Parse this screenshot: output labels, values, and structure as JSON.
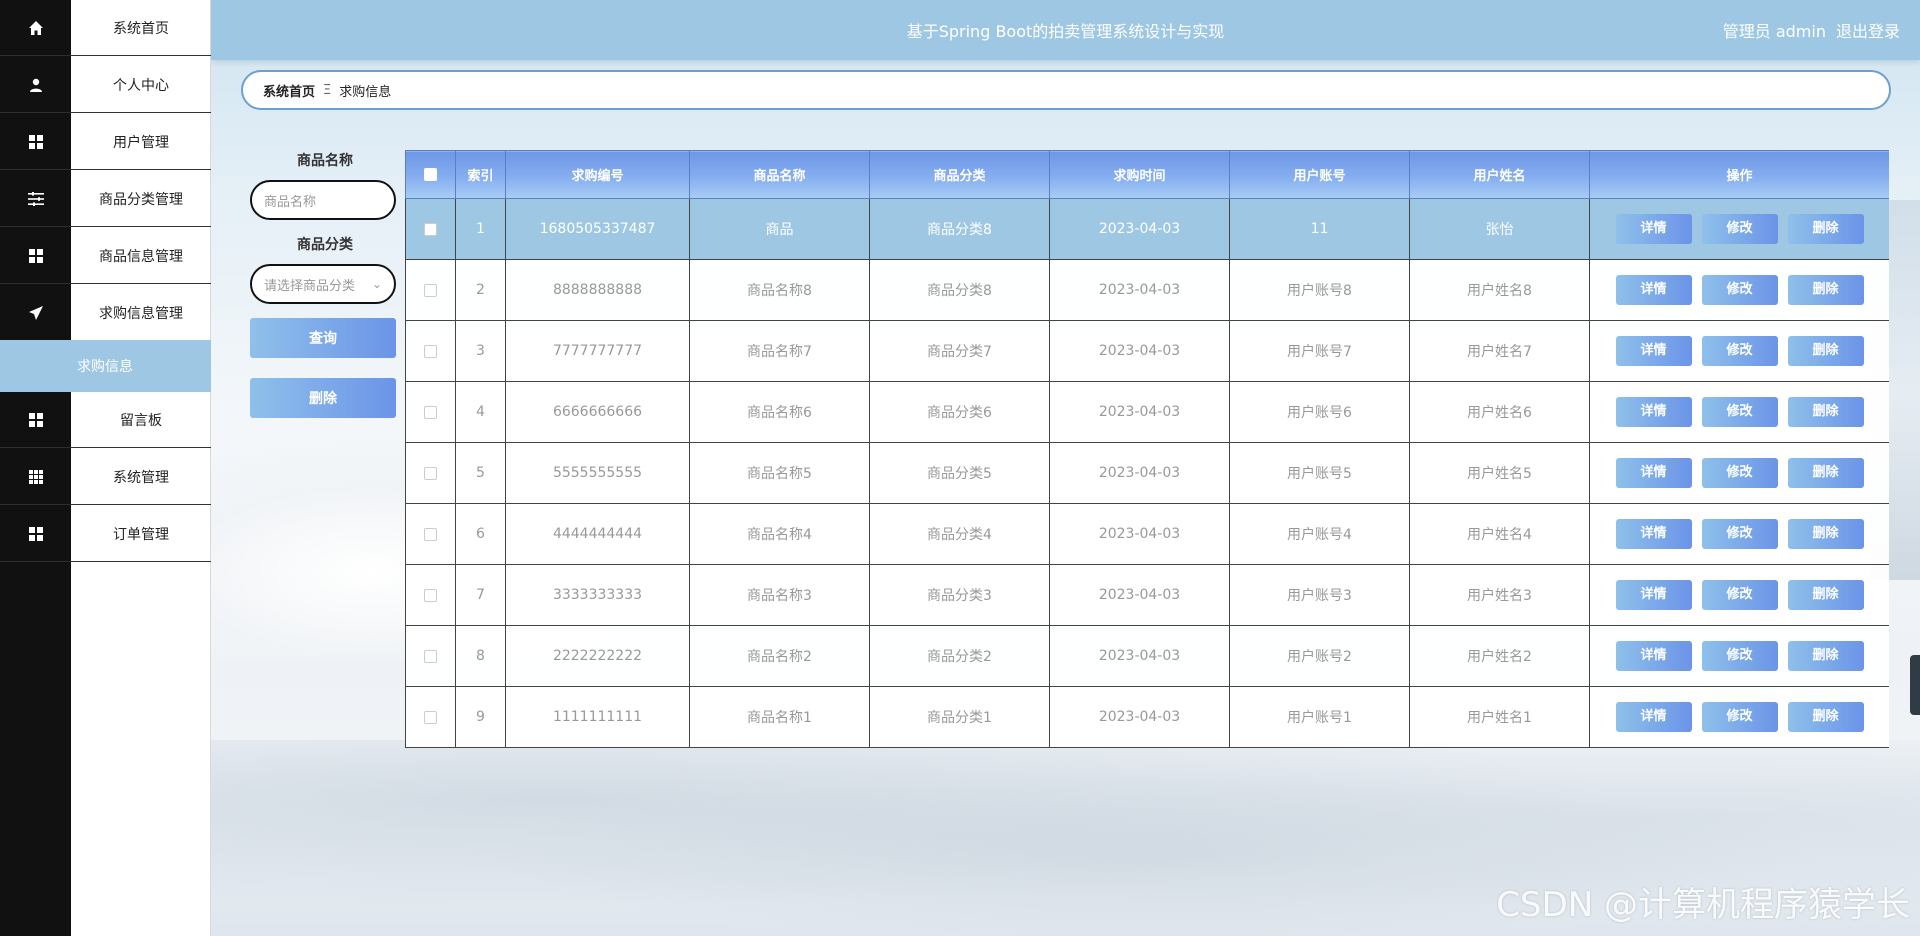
{
  "app": {
    "title": "基于Spring Boot的拍卖管理系统设计与实现",
    "user_label": "管理员 admin",
    "logout": "退出登录"
  },
  "sidebar": {
    "items": [
      {
        "label": "系统首页",
        "icon": "home-icon"
      },
      {
        "label": "个人中心",
        "icon": "user-icon"
      },
      {
        "label": "用户管理",
        "icon": "grid-icon"
      },
      {
        "label": "商品分类管理",
        "icon": "sliders-icon"
      },
      {
        "label": "商品信息管理",
        "icon": "grid-icon"
      },
      {
        "label": "求购信息管理",
        "icon": "send-icon"
      },
      {
        "label": "留言板",
        "icon": "grid-icon"
      },
      {
        "label": "系统管理",
        "icon": "apps-icon"
      },
      {
        "label": "订单管理",
        "icon": "grid-icon"
      }
    ],
    "active_sub": "求购信息"
  },
  "breadcrumb": {
    "home": "系统首页",
    "sep": "Ξ",
    "current": "求购信息"
  },
  "search": {
    "name_label": "商品名称",
    "name_placeholder": "商品名称",
    "category_label": "商品分类",
    "category_placeholder": "请选择商品分类",
    "query_button": "查询",
    "delete_button": "删除"
  },
  "table": {
    "headers": [
      "索引",
      "求购编号",
      "商品名称",
      "商品分类",
      "求购时间",
      "用户账号",
      "用户姓名",
      "操作"
    ],
    "actions": {
      "detail": "详情",
      "edit": "修改",
      "delete": "删除"
    },
    "rows": [
      {
        "idx": "1",
        "no": "1680505337487",
        "name": "商品",
        "category": "商品分类8",
        "time": "2023-04-03",
        "account": "11",
        "username": "张怡"
      },
      {
        "idx": "2",
        "no": "8888888888",
        "name": "商品名称8",
        "category": "商品分类8",
        "time": "2023-04-03",
        "account": "用户账号8",
        "username": "用户姓名8"
      },
      {
        "idx": "3",
        "no": "7777777777",
        "name": "商品名称7",
        "category": "商品分类7",
        "time": "2023-04-03",
        "account": "用户账号7",
        "username": "用户姓名7"
      },
      {
        "idx": "4",
        "no": "6666666666",
        "name": "商品名称6",
        "category": "商品分类6",
        "time": "2023-04-03",
        "account": "用户账号6",
        "username": "用户姓名6"
      },
      {
        "idx": "5",
        "no": "5555555555",
        "name": "商品名称5",
        "category": "商品分类5",
        "time": "2023-04-03",
        "account": "用户账号5",
        "username": "用户姓名5"
      },
      {
        "idx": "6",
        "no": "4444444444",
        "name": "商品名称4",
        "category": "商品分类4",
        "time": "2023-04-03",
        "account": "用户账号4",
        "username": "用户姓名4"
      },
      {
        "idx": "7",
        "no": "3333333333",
        "name": "商品名称3",
        "category": "商品分类3",
        "time": "2023-04-03",
        "account": "用户账号3",
        "username": "用户姓名3"
      },
      {
        "idx": "8",
        "no": "2222222222",
        "name": "商品名称2",
        "category": "商品分类2",
        "time": "2023-04-03",
        "account": "用户账号2",
        "username": "用户姓名2"
      },
      {
        "idx": "9",
        "no": "1111111111",
        "name": "商品名称1",
        "category": "商品分类1",
        "time": "2023-04-03",
        "account": "用户账号1",
        "username": "用户姓名1"
      }
    ]
  },
  "watermark": "CSDN @计算机程序猿学长"
}
